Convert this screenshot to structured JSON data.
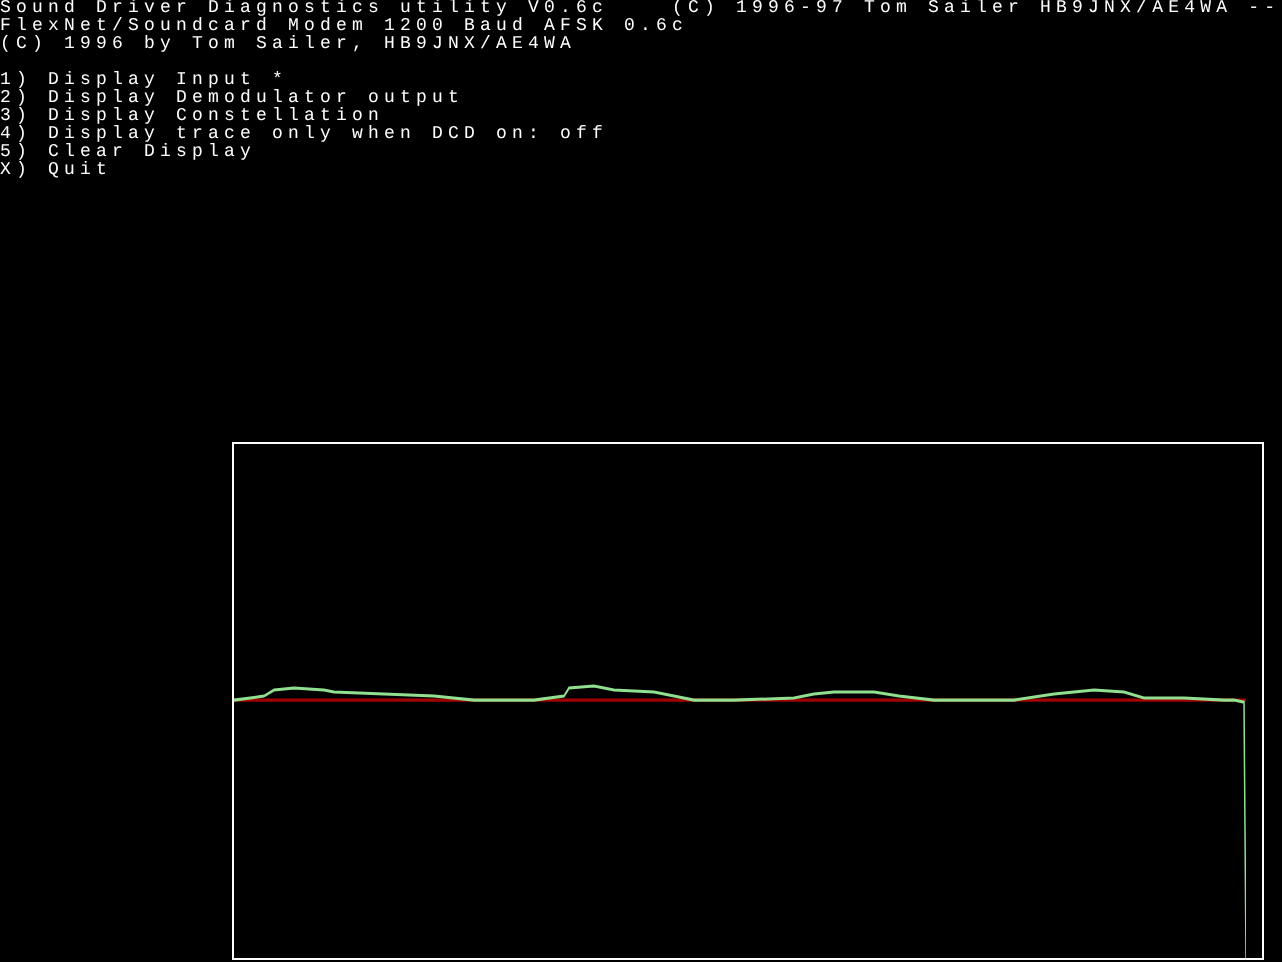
{
  "header_lines": [
    "Sound Driver Diagnostics utility V0.6c    (C) 1996-97 Tom Sailer HB9JNX/AE4WA --",
    "FlexNet/Soundcard Modem 1200 Baud AFSK 0.6c",
    "(C) 1996 by Tom Sailer, HB9JNX/AE4WA"
  ],
  "menu": [
    "1) Display Input *",
    "2) Display Demodulator output",
    "3) Display Constellation",
    "4) Display trace only when DCD on: off",
    "5) Clear Display",
    "X) Quit"
  ]
}
